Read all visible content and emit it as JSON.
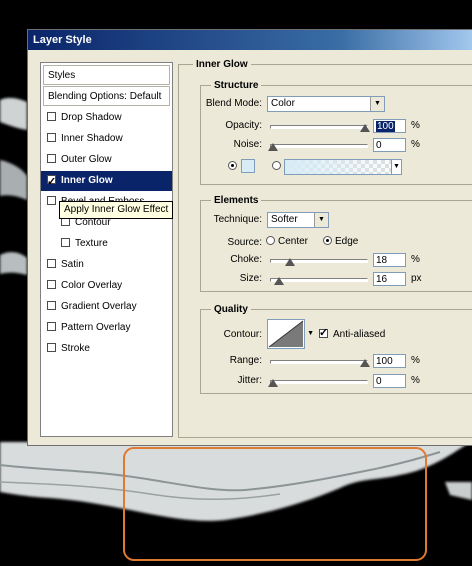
{
  "dialog": {
    "title": "Layer Style"
  },
  "sidebar": {
    "styles_label": "Styles",
    "blending_label": "Blending Options: Default",
    "items": [
      {
        "label": "Drop Shadow",
        "checked": false
      },
      {
        "label": "Inner Shadow",
        "checked": false
      },
      {
        "label": "Outer Glow",
        "checked": false
      },
      {
        "label": "Inner Glow",
        "checked": true
      },
      {
        "label": "Bevel and Emboss",
        "checked": false
      },
      {
        "label": "Contour",
        "checked": false
      },
      {
        "label": "Texture",
        "checked": false
      },
      {
        "label": "Satin",
        "checked": false
      },
      {
        "label": "Color Overlay",
        "checked": false
      },
      {
        "label": "Gradient Overlay",
        "checked": false
      },
      {
        "label": "Pattern Overlay",
        "checked": false
      },
      {
        "label": "Stroke",
        "checked": false
      }
    ],
    "tooltip": "Apply Inner Glow Effect"
  },
  "panel": {
    "title": "Inner Glow",
    "structure": {
      "legend": "Structure",
      "blend_mode_label": "Blend Mode:",
      "blend_mode_value": "Color",
      "opacity_label": "Opacity:",
      "opacity_value": "100",
      "opacity_unit": "%",
      "opacity_level": 1.0,
      "noise_label": "Noise:",
      "noise_value": "0",
      "noise_unit": "%",
      "noise_level": 0.0,
      "glow_color": "#d8ecf6"
    },
    "elements": {
      "legend": "Elements",
      "technique_label": "Technique:",
      "technique_value": "Softer",
      "source_label": "Source:",
      "source_center": "Center",
      "source_edge": "Edge",
      "choke_label": "Choke:",
      "choke_value": "18",
      "choke_unit": "%",
      "choke_level": 0.18,
      "size_label": "Size:",
      "size_value": "16",
      "size_unit": "px",
      "size_level": 0.06
    },
    "quality": {
      "legend": "Quality",
      "contour_label": "Contour:",
      "antialiased_label": "Anti-aliased",
      "range_label": "Range:",
      "range_value": "100",
      "range_unit": "%",
      "range_level": 1.0,
      "jitter_label": "Jitter:",
      "jitter_value": "0",
      "jitter_unit": "%",
      "jitter_level": 0.0
    }
  },
  "colors": {
    "selection": "#0a246a",
    "highlight_box": "#e07a30"
  }
}
